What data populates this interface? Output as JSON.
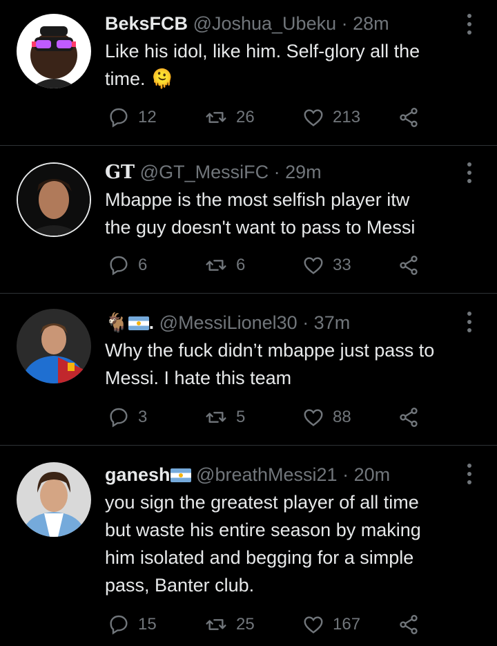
{
  "tweets": [
    {
      "name": "BeksFCB",
      "handle": "@Joshua_Ubeku",
      "time": "· 28m",
      "lines": [
        "Like his idol, like him. Self-glory all the",
        "time. 🫠"
      ],
      "replies": "12",
      "retweets": "26",
      "likes": "213"
    },
    {
      "name": "GT",
      "handle": "@GT_MessiFC",
      "time": "· 29m",
      "lines": [
        "Mbappe is the most selfish player itw",
        "the guy doesn't want to pass to Messi"
      ],
      "replies": "6",
      "retweets": "6",
      "likes": "33"
    },
    {
      "name": "🐐",
      "name_suffix": ".",
      "handle": "@MessiLionel30",
      "time": "· 37m",
      "lines": [
        "Why the fuck didn’t mbappe just pass to",
        "Messi. I hate this team"
      ],
      "replies": "3",
      "retweets": "5",
      "likes": "88"
    },
    {
      "name": "ganesh",
      "handle": "@breathMessi21",
      "time": "· 20m",
      "lines": [
        "you sign the greatest player of all time",
        "but waste his entire season by making",
        "him isolated and begging for a simple",
        "pass, Banter club."
      ],
      "replies": "15",
      "retweets": "25",
      "likes": "167"
    }
  ],
  "colors": {
    "background": "#000000",
    "text": "#e7e9ea",
    "muted": "#71767b",
    "divider": "#2f3336"
  },
  "icons": [
    "reply-icon",
    "retweet-icon",
    "like-icon",
    "share-icon",
    "more-icon",
    "argentina-flag-icon",
    "goat-emoji-icon"
  ]
}
